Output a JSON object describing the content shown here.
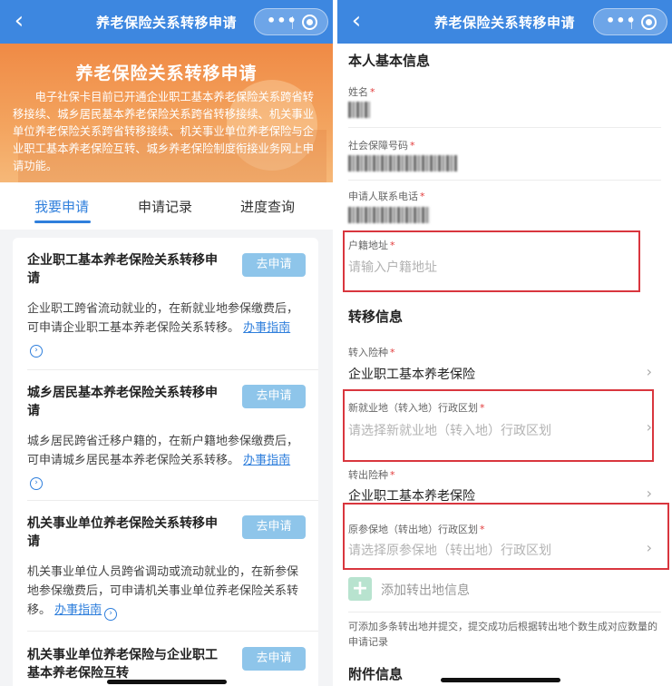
{
  "navbar": {
    "back_glyph": "‹",
    "title": "养老保险关系转移申请",
    "more_glyph": "•••"
  },
  "left": {
    "banner": {
      "title": "养老保险关系转移申请",
      "desc": "电子社保卡目前已开通企业职工基本养老保险关系跨省转移接续、城乡居民基本养老保险关系跨省转移接续、机关事业单位养老保险关系跨省转移接续、机关事业单位养老保险与企业职工基本养老保险互转、城乡养老保险制度衔接业务网上申请功能。"
    },
    "tabs": [
      "我要申请",
      "申请记录",
      "进度查询"
    ],
    "cards": [
      {
        "title": "企业职工基本养老保险关系转移申请",
        "button": "去申请",
        "desc": "企业职工跨省流动就业的，在新就业地参保缴费后，可申请企业职工基本养老保险关系转移。",
        "link": "办事指南"
      },
      {
        "title": "城乡居民基本养老保险关系转移申请",
        "button": "去申请",
        "desc": "城乡居民跨省迁移户籍的，在新户籍地参保缴费后，可申请城乡居民基本养老保险关系转移。",
        "link": "办事指南"
      },
      {
        "title": "机关事业单位养老保险关系转移申请",
        "button": "去申请",
        "desc": "机关事业单位人员跨省调动或流动就业的，在新参保地参保缴费后，可申请机关事业单位养老保险关系转移。",
        "link": "办事指南"
      },
      {
        "title": "机关事业单位养老保险与企业职工基本养老保险互转",
        "button": "去申请"
      }
    ]
  },
  "right": {
    "basic_section": "本人基本信息",
    "name_label": "姓名",
    "ssn_label": "社会保障号码",
    "phone_label": "申请人联系电话",
    "hukou_label": "户籍地址",
    "hukou_placeholder": "请输入户籍地址",
    "transfer_section": "转移信息",
    "in_type_label": "转入险种",
    "in_type_value": "企业职工基本养老保险",
    "new_area_label": "新就业地（转入地）行政区划",
    "new_area_placeholder": "请选择新就业地（转入地）行政区划",
    "out_type_label": "转出险种",
    "out_type_value": "企业职工基本养老保险",
    "old_area_label": "原参保地（转出地）行政区划",
    "old_area_placeholder": "请选择原参保地（转出地）行政区划",
    "add_out_label": "添加转出地信息",
    "hint": "可添加多条转出地并提交，提交成功后根据转出地个数生成对应数量的申请记录",
    "attach_section": "附件信息",
    "required_mark": "*",
    "chevron": "›",
    "plus": "+"
  },
  "colors": {
    "nav": "#3d87e0",
    "accent": "#2f7fdc",
    "button": "#8ec5ea",
    "highlight": "#d9363e",
    "banner": "#f08a45"
  }
}
